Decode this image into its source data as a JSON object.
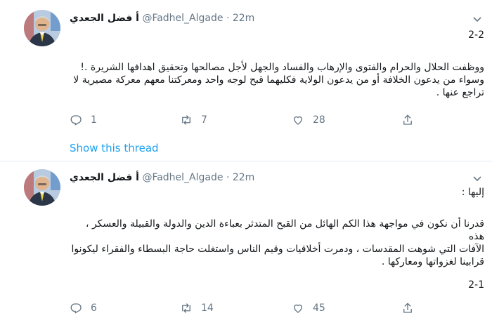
{
  "tweets": [
    {
      "author_name": "أ فضل الجعدي",
      "handle": "@Fadhel_Algade",
      "separator": "·",
      "time": "22m",
      "thread_marker": "2-2",
      "lines": [
        "ووظفت الحلال والحرام والفتوى والإرهاب والفساد والجهل لأجل مصالحها وتحقيق اهدافها الشريرة .!",
        "وسواء من يدعون الخلافة أو من يدعون الولاية فكليهما قبح لوجه واحد ومعركتنا معهم معركة مصيرية لا",
        "تراجع عنها ."
      ],
      "replies": "1",
      "retweets": "7",
      "likes": "28",
      "show_thread": "Show this thread"
    },
    {
      "author_name": "أ فضل الجعدي",
      "handle": "@Fadhel_Algade",
      "separator": "·",
      "time": "22m",
      "intro": "إليها :",
      "lines": [
        "قدرنا أن نكون في مواجهة هذا الكم الهائل من القبح المتدثر بعباءة الدين والدولة والقبيلة والعسكر ، هذه",
        "الآفات التي شوهت المقدسات ، ودمرت أخلاقيات وقيم الناس واستغلت حاجة البسطاء والفقراء ليكونوا",
        "قرابينا لغزواتها ومعاركها ."
      ],
      "thread_marker": "2-1",
      "replies": "6",
      "retweets": "14",
      "likes": "45"
    }
  ],
  "icons": {
    "reply": "reply-icon",
    "retweet": "retweet-icon",
    "like": "like-icon",
    "share": "share-icon",
    "caret": "chevron-down-icon"
  },
  "colors": {
    "link": "#1da1f2",
    "muted": "#657786",
    "text": "#14171a",
    "border": "#e6ecf0"
  }
}
